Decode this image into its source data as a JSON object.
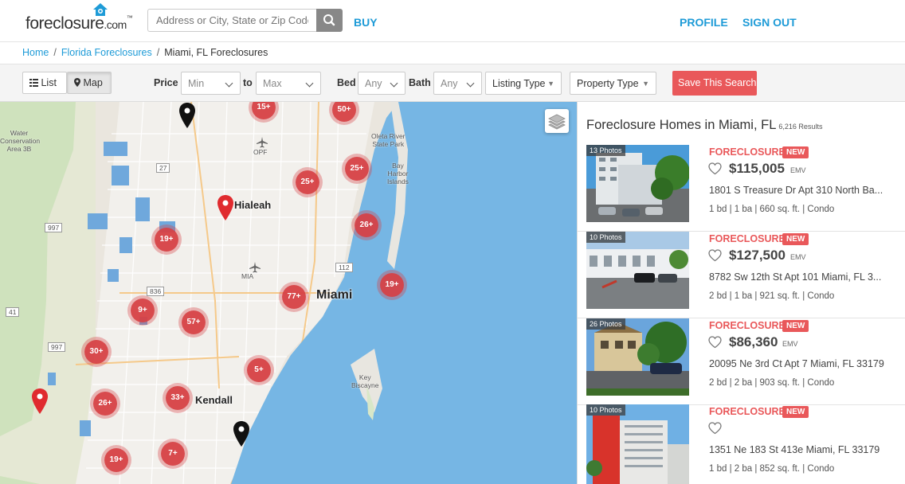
{
  "logo": {
    "main": "foreclosure",
    "suffix": ".com",
    "tm": "™"
  },
  "search": {
    "placeholder": "Address or City, State or Zip Code"
  },
  "nav": {
    "buy": "BUY",
    "profile": "PROFILE",
    "signout": "SIGN OUT"
  },
  "breadcrumb": {
    "home": "Home",
    "state": "Florida Foreclosures",
    "current": "Miami, FL Foreclosures",
    "sep": "/"
  },
  "filters": {
    "list": "List",
    "map": "Map",
    "price_label": "Price",
    "price_min": "Min",
    "to": "to",
    "price_max": "Max",
    "bed_label": "Bed",
    "bed_value": "Any",
    "bath_label": "Bath",
    "bath_value": "Any",
    "listing_type": "Listing Type",
    "property_type": "Property Type",
    "save_search": "Save This Search"
  },
  "map": {
    "labels": {
      "hialeah": "Hialeah",
      "miami": "Miami",
      "kendall": "Kendall",
      "mia": "MIA",
      "opf": "OPF",
      "water_conservation": "Water\nConservation\nArea 3B",
      "oleta": "Oleta River\nState Park",
      "bay_harbor": "Bay\nHarbor\nIslands",
      "key_biscayne": "Key\nBiscayne",
      "r997a": "997",
      "r997b": "997",
      "r27": "27",
      "r836": "836",
      "r41": "41",
      "r112": "112"
    },
    "clusters": [
      "15+",
      "50+",
      "25+",
      "25+",
      "26+",
      "19+",
      "19+",
      "77+",
      "9+",
      "57+",
      "30+",
      "5+",
      "33+",
      "26+",
      "7+",
      "19+"
    ]
  },
  "results": {
    "title": "Foreclosure Homes in Miami, FL",
    "count": "6,216 Results",
    "listings": [
      {
        "photos": "13 Photos",
        "type": "FORECLOSURE",
        "badge": "NEW",
        "price": "$115,005",
        "emv": "EMV",
        "address": "1801 S Treasure Dr Apt 310 North Ba...",
        "details": "1 bd | 1 ba | 660 sq. ft. | Condo"
      },
      {
        "photos": "10 Photos",
        "type": "FORECLOSURE",
        "badge": "NEW",
        "price": "$127,500",
        "emv": "EMV",
        "address": "8782 Sw 12th St Apt 101 Miami, FL 3...",
        "details": "2 bd | 1 ba | 921 sq. ft. | Condo"
      },
      {
        "photos": "26 Photos",
        "type": "FORECLOSURE",
        "badge": "NEW",
        "price": "$86,360",
        "emv": "EMV",
        "address": "20095 Ne 3rd Ct Apt 7 Miami, FL 33179",
        "details": "2 bd | 2 ba | 903 sq. ft. | Condo"
      },
      {
        "photos": "10 Photos",
        "type": "FORECLOSURE",
        "badge": "NEW",
        "price": "",
        "emv": "",
        "address": "1351 Ne 183 St 413e Miami, FL 33179",
        "details": "1 bd | 2 ba | 852 sq. ft. | Condo"
      }
    ]
  },
  "colors": {
    "brand_blue": "#1e9bd7",
    "accent_red": "#e9585a",
    "water": "#76b6e4",
    "cluster": "#d64045"
  }
}
